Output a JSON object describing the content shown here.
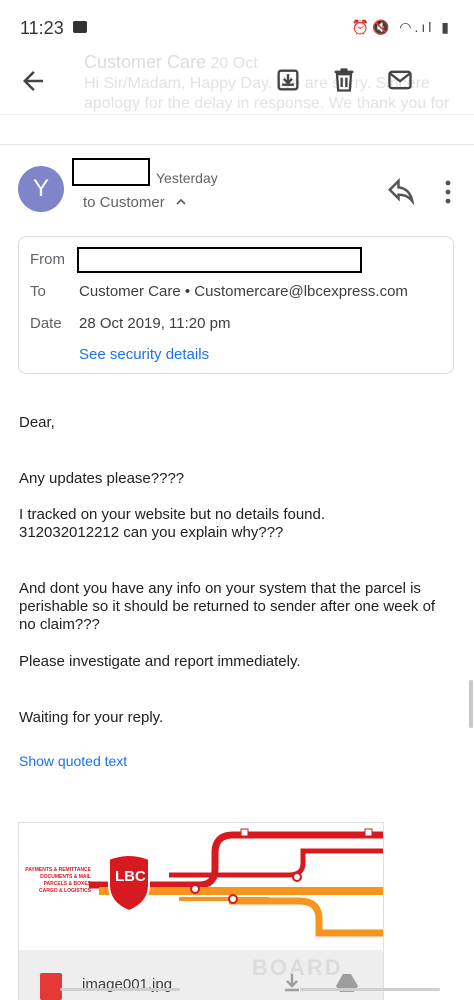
{
  "status_bar": {
    "time": "11:23",
    "icons": "⏰🔇 ◠.ıl ▮"
  },
  "toolbar": {
    "faded_sender": "Customer Care",
    "faded_date": "20 Oct",
    "faded_snippet": "Hi Sir/Madam, Happy Day. We are sorry. Sincere apology for the delay in response. We thank you for"
  },
  "message": {
    "avatar_letter": "Y",
    "date": "Yesterday",
    "to_line": "to Customer",
    "details": {
      "from_label": "From",
      "to_label": "To",
      "to_value": "Customer Care • Customercare@lbcexpress.com",
      "date_label": "Date",
      "date_value": "28 Oct 2019, 11:20 pm",
      "security_link": "See security details"
    },
    "body": {
      "greeting": "Dear,",
      "line1": "Any updates please????",
      "line2a": "I tracked on your website but no details found.",
      "line2b": "312032012212 can you explain why???",
      "line3a": "And dont you have any info on your system that the parcel is",
      "line3b": "perishable so it should be returned to sender after one week of",
      "line3c": "no claim???",
      "line4": "Please investigate and report immediately.",
      "line5": "Waiting for your reply."
    },
    "show_quoted": "Show quoted text"
  },
  "attachment": {
    "filename": "image001.jpg",
    "logo_text": "LBC",
    "services": [
      "PAYMENTS & REMITTANCE",
      "DOCUMENTS & MAIL",
      "PARCELS & BOXES",
      "CARGO & LOGISTICS"
    ],
    "watermark": "BOARD"
  },
  "colors": {
    "avatar": "#7e86c9",
    "link": "#1a73e8",
    "lbc_red": "#d71920",
    "lbc_orange": "#f7941d"
  }
}
